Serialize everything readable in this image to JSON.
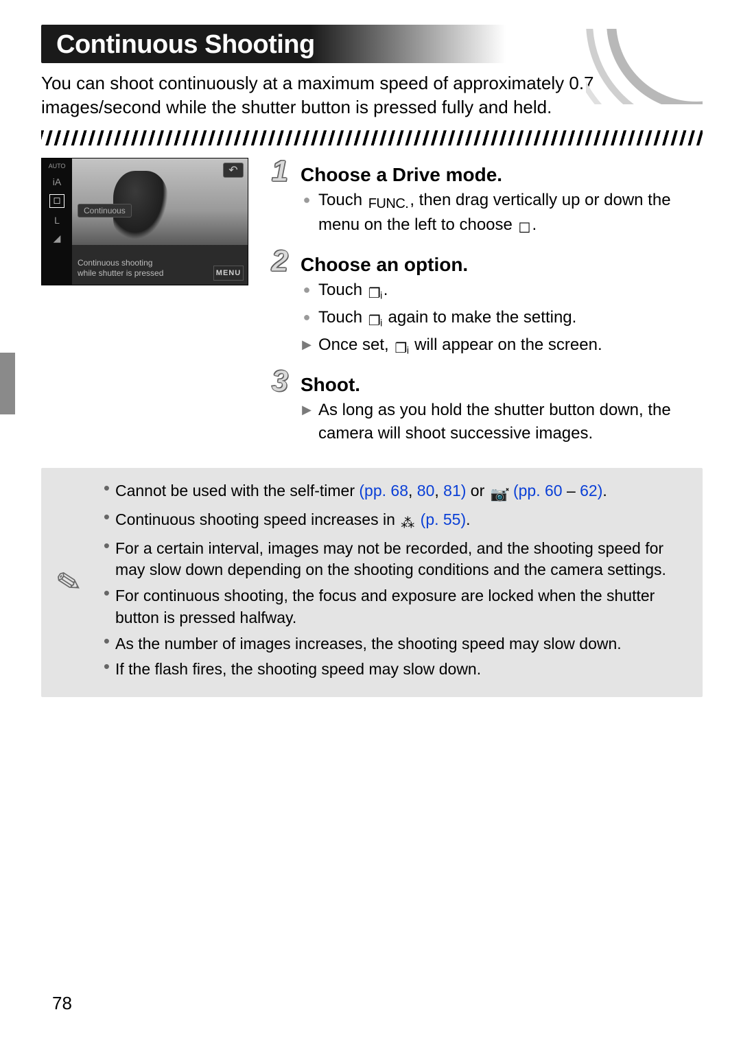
{
  "title": "Continuous Shooting",
  "intro": "You can shoot continuously at a maximum speed of approximately 0.7 images/second while the shutter button is pressed fully and held.",
  "screenshot": {
    "mode_label": "Continuous",
    "desc_line1": "Continuous shooting",
    "desc_line2": "while shutter is pressed",
    "menu_btn": "MENU",
    "back_btn": "↶",
    "side_icons": [
      "AUTO",
      "iA",
      "☐",
      "L",
      "◢"
    ],
    "selected_icon": "☐"
  },
  "steps": [
    {
      "num": "1",
      "title": "Choose a Drive mode.",
      "bullets": [
        {
          "type": "circle",
          "pre": "Touch ",
          "mid_icon": "FUNC.",
          "post": ", then drag vertically up or down the menu on the left to choose ",
          "end_icon": "☐",
          "after": "."
        }
      ]
    },
    {
      "num": "2",
      "title": "Choose an option.",
      "bullets": [
        {
          "type": "circle",
          "pre": "Touch ",
          "mid_icon": "❐ᵢ",
          "post": "."
        },
        {
          "type": "circle",
          "pre": "Touch ",
          "mid_icon": "❐ᵢ",
          "post": " again to make the setting."
        },
        {
          "type": "arrow",
          "pre": "Once set, ",
          "mid_icon": "❐ᵢ",
          "post": " will appear on the screen."
        }
      ]
    },
    {
      "num": "3",
      "title": "Shoot.",
      "bullets": [
        {
          "type": "arrow",
          "pre": "As long as you hold the shutter button down, the camera will shoot successive images."
        }
      ]
    }
  ],
  "notes": [
    {
      "segments": [
        {
          "t": "Cannot be used with the self-timer "
        },
        {
          "t": "(pp. 68",
          "link": true
        },
        {
          "t": ", "
        },
        {
          "t": "80",
          "link": true
        },
        {
          "t": ", "
        },
        {
          "t": "81",
          "link": true
        },
        {
          "t": ")",
          "link": true
        },
        {
          "t": " or "
        },
        {
          "icon": "📷̽"
        },
        {
          "t": " "
        },
        {
          "t": "(pp. 60",
          "link": true
        },
        {
          "t": " – "
        },
        {
          "t": "62",
          "link": true
        },
        {
          "t": ")",
          "link": true
        },
        {
          "t": "."
        }
      ]
    },
    {
      "segments": [
        {
          "t": "Continuous shooting speed increases in "
        },
        {
          "icon": "⁂"
        },
        {
          "t": " "
        },
        {
          "t": "(p. 55)",
          "link": true
        },
        {
          "t": "."
        }
      ]
    },
    {
      "segments": [
        {
          "t": "For a certain interval, images may not be recorded, and the shooting speed for may slow down depending on the shooting conditions and the camera settings."
        }
      ]
    },
    {
      "segments": [
        {
          "t": "For continuous shooting, the focus and exposure are locked when the shutter button is pressed halfway."
        }
      ]
    },
    {
      "segments": [
        {
          "t": "As the number of images increases, the shooting speed may slow down."
        }
      ]
    },
    {
      "segments": [
        {
          "t": "If the flash fires, the shooting speed may slow down."
        }
      ]
    }
  ],
  "page_number": "78"
}
